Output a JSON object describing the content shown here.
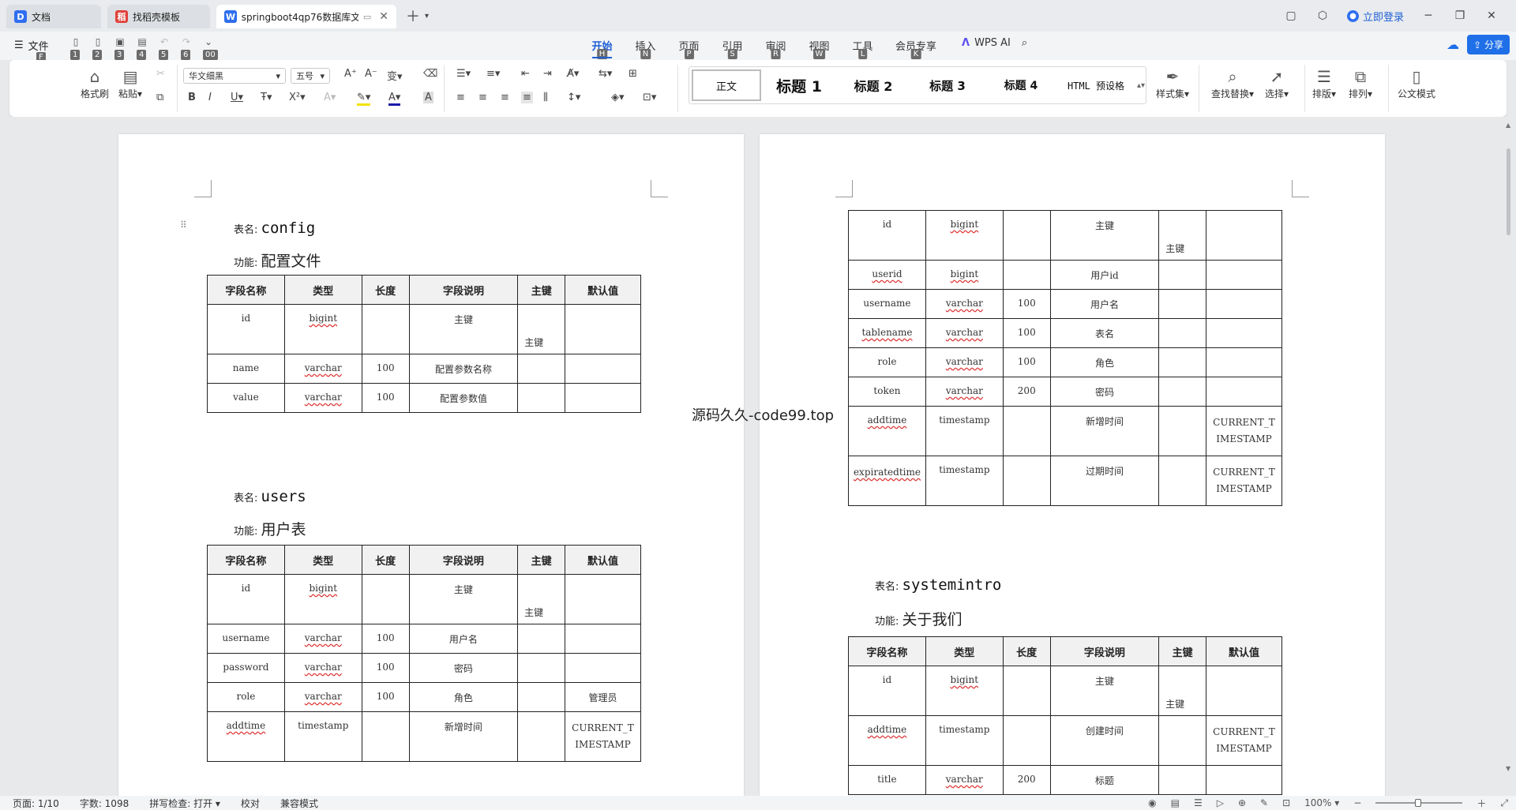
{
  "tabs": [
    {
      "label": "文档",
      "icon": "docs-icon",
      "color": "#2f6ef0",
      "glyph": "D"
    },
    {
      "label": "找稻壳模板",
      "icon": "docer-icon",
      "color": "#e0413a",
      "glyph": "稻"
    },
    {
      "label": "springboot4qp76数据库文",
      "icon": "wps-writer-icon",
      "color": "#2f6ef0",
      "glyph": "W",
      "active": true
    }
  ],
  "titlebar": {
    "login": "立即登录"
  },
  "menubar": {
    "file": "文件",
    "file_key": "F",
    "quick_keys": [
      "1",
      "2",
      "3",
      "4",
      "5",
      "6",
      "00"
    ],
    "menus": [
      {
        "label": "开始",
        "key": "H",
        "active": true
      },
      {
        "label": "插入",
        "key": "N"
      },
      {
        "label": "页面",
        "key": "P"
      },
      {
        "label": "引用",
        "key": "S"
      },
      {
        "label": "审阅",
        "key": "R"
      },
      {
        "label": "视图",
        "key": "W"
      },
      {
        "label": "工具",
        "key": "L"
      },
      {
        "label": "会员专享",
        "key": "K"
      }
    ],
    "wps_ai": "WPS AI",
    "share": "分享"
  },
  "ribbon": {
    "format_painter": "格式刷",
    "paste": "粘贴",
    "font_name": "华文细黑",
    "font_size": "五号",
    "styles": [
      "正文",
      "标题 1",
      "标题 2",
      "标题 3",
      "标题 4",
      "HTML 预设格"
    ],
    "style_set": "样式集",
    "find_replace": "查找替换",
    "select": "选择",
    "layout": "排版",
    "arrange": "排列",
    "official_mode": "公文模式"
  },
  "doc": {
    "label_table": "表名:",
    "label_func": "功能:",
    "headers": [
      "字段名称",
      "类型",
      "长度",
      "字段说明",
      "主键",
      "默认值"
    ],
    "watermark": "源码久久-code99.top",
    "config": {
      "name": "config",
      "func": "配置文件",
      "rows": [
        {
          "f": "id",
          "t": "bigint",
          "l": "",
          "d": "主键",
          "pk": "主键",
          "def": ""
        },
        {
          "f": "name",
          "t": "varchar",
          "l": "100",
          "d": "配置参数名称",
          "pk": "",
          "def": ""
        },
        {
          "f": "value",
          "t": "varchar",
          "l": "100",
          "d": "配置参数值",
          "pk": "",
          "def": ""
        }
      ]
    },
    "users": {
      "name": "users",
      "func": "用户表",
      "rows": [
        {
          "f": "id",
          "t": "bigint",
          "l": "",
          "d": "主键",
          "pk": "主键",
          "def": ""
        },
        {
          "f": "username",
          "t": "varchar",
          "l": "100",
          "d": "用户名",
          "pk": "",
          "def": ""
        },
        {
          "f": "password",
          "t": "varchar",
          "l": "100",
          "d": "密码",
          "pk": "",
          "def": ""
        },
        {
          "f": "role",
          "t": "varchar",
          "l": "100",
          "d": "角色",
          "pk": "",
          "def": "管理员"
        },
        {
          "f": "addtime",
          "t": "timestamp",
          "l": "",
          "d": "新增时间",
          "pk": "",
          "def": "CURRENT_TIMESTAMP"
        }
      ]
    },
    "token": {
      "rows": [
        {
          "f": "id",
          "t": "bigint",
          "l": "",
          "d": "主键",
          "pk": "主键",
          "def": ""
        },
        {
          "f": "userid",
          "t": "bigint",
          "l": "",
          "d": "用户id",
          "pk": "",
          "def": ""
        },
        {
          "f": "username",
          "t": "varchar",
          "l": "100",
          "d": "用户名",
          "pk": "",
          "def": ""
        },
        {
          "f": "tablename",
          "t": "varchar",
          "l": "100",
          "d": "表名",
          "pk": "",
          "def": ""
        },
        {
          "f": "role",
          "t": "varchar",
          "l": "100",
          "d": "角色",
          "pk": "",
          "def": ""
        },
        {
          "f": "token",
          "t": "varchar",
          "l": "200",
          "d": "密码",
          "pk": "",
          "def": ""
        },
        {
          "f": "addtime",
          "t": "timestamp",
          "l": "",
          "d": "新增时间",
          "pk": "",
          "def": "CURRENT_TIMESTAMP"
        },
        {
          "f": "expiratedtime",
          "t": "timestamp",
          "l": "",
          "d": "过期时间",
          "pk": "",
          "def": "CURRENT_TIMESTAMP"
        }
      ]
    },
    "systemintro": {
      "name": "systemintro",
      "func": "关于我们",
      "rows": [
        {
          "f": "id",
          "t": "bigint",
          "l": "",
          "d": "主键",
          "pk": "主键",
          "def": ""
        },
        {
          "f": "addtime",
          "t": "timestamp",
          "l": "",
          "d": "创建时间",
          "pk": "",
          "def": "CURRENT_TIMESTAMP"
        },
        {
          "f": "title",
          "t": "varchar",
          "l": "200",
          "d": "标题",
          "pk": "",
          "def": ""
        }
      ]
    }
  },
  "status": {
    "page": "页面: 1/10",
    "words": "字数: 1098",
    "spell": "拼写检查: 打开",
    "proof": "校对",
    "compat": "兼容模式",
    "zoom": "100%"
  }
}
